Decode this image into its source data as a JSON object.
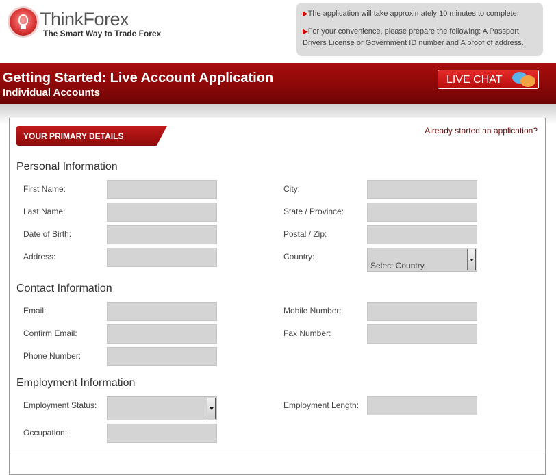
{
  "brand": {
    "name": "ThinkForex",
    "tagline": "The Smart Way to Trade Forex"
  },
  "notice": {
    "line1": "The application will take approximately 10 minutes to complete.",
    "line2a": "For your convenience, please prepare the following: A Passport,",
    "line2b": "Drivers License or Government ID number and A proof of address."
  },
  "banner": {
    "title": "Getting Started: Live Account Application",
    "subtitle": "Individual Accounts",
    "live_chat": "LIVE CHAT"
  },
  "form": {
    "step_label": "YOUR PRIMARY DETAILS",
    "already_started": "Already started an application?",
    "personal": {
      "heading": "Personal Information",
      "first_name": "First Name:",
      "last_name": "Last Name:",
      "dob": "Date of Birth:",
      "address": "Address:",
      "city": "City:",
      "state": "State / Province:",
      "postal": "Postal / Zip:",
      "country": "Country:",
      "country_value": "Select Country"
    },
    "contact": {
      "heading": "Contact Information",
      "email": "Email:",
      "confirm_email": "Confirm Email:",
      "phone": "Phone Number:",
      "mobile": "Mobile Number:",
      "fax": "Fax Number:"
    },
    "employment": {
      "heading": "Employment Information",
      "status": "Employment Status:",
      "status_value": "",
      "length": "Employment Length:",
      "occupation": "Occupation:"
    }
  },
  "colors": {
    "brand_red": "#8c0808",
    "field_bg": "#d4d4d4",
    "accent_arrow": "#cc0000"
  }
}
